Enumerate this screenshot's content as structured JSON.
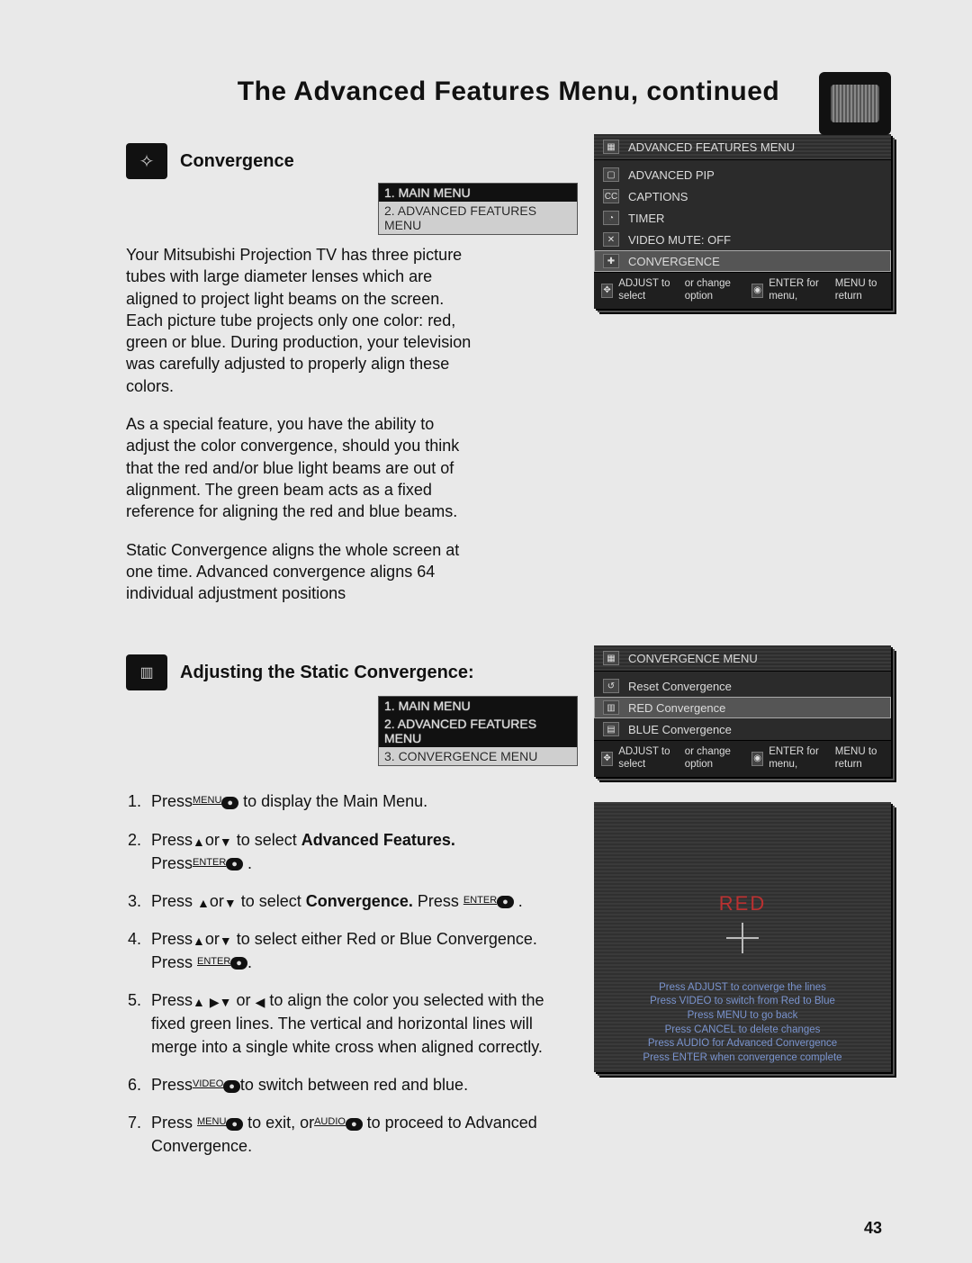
{
  "title": "The Advanced Features Menu, continued",
  "page_number": "43",
  "section1": {
    "heading": "Convergence",
    "crumbs": {
      "line1": "1. MAIN MENU",
      "line2": "2. ADVANCED FEATURES MENU"
    },
    "p1": "Your Mitsubishi Projection TV has three picture tubes with large diameter lenses which are aligned to project light beams on the screen. Each picture tube projects only one color: red, green or blue. During production, your television was carefully adjusted to properly align these colors.",
    "p2": "As a special feature, you have the ability to adjust the color convergence, should you think that the red and/or blue light beams are out of alignment. The green beam acts as a fixed reference for aligning the red and blue beams.",
    "p3": "Static Convergence aligns the whole screen at one time. Advanced convergence aligns 64 individual adjustment positions"
  },
  "tv1": {
    "header": "ADVANCED FEATURES MENU",
    "items": {
      "a": "ADVANCED PIP",
      "b": "CAPTIONS",
      "c": "TIMER",
      "d": "VIDEO MUTE: OFF",
      "e": "CONVERGENCE"
    },
    "foot_l1": "ADJUST  to select",
    "foot_l2": "or change option",
    "foot_r1": "ENTER for menu,",
    "foot_r2": "MENU to return"
  },
  "section2": {
    "heading": "Adjusting the Static Convergence:",
    "crumbs": {
      "line1": "1. MAIN MENU",
      "line2": "2. ADVANCED FEATURES MENU",
      "line3": "3. CONVERGENCE MENU"
    }
  },
  "tv2": {
    "header": "CONVERGENCE MENU",
    "items": {
      "a": "Reset Convergence",
      "b": "RED Convergence",
      "c": "BLUE Convergence"
    },
    "foot_l1": "ADJUST  to select",
    "foot_l2": "or change option",
    "foot_r1": "ENTER for menu,",
    "foot_r2": "MENU to return"
  },
  "redscreen": {
    "title": "RED",
    "l1": "Press ADJUST to converge the lines",
    "l2": "Press VIDEO to switch from Red to Blue",
    "l3": "Press MENU to go back",
    "l4": "Press CANCEL to delete changes",
    "l5": "Press AUDIO for Advanced Convergence",
    "l6": "Press ENTER when convergence complete"
  },
  "steps": {
    "s1a": "Press",
    "s1_btn_sup": "MENU",
    "s1b": " to display the Main Menu.",
    "s2a": "Press",
    "s2_mid": "or",
    "s2b": " to select ",
    "s2_bold": "Advanced Features.",
    "s2c": "Press",
    "s2_sup": "ENTER",
    "s2d": " .",
    "s3a": "Press ",
    "s3_mid": "or",
    "s3b": " to select ",
    "s3_bold": "Convergence.",
    "s3c": " Press ",
    "s3_sup": "ENTER",
    "s3d": " .",
    "s4a": "Press",
    "s4_mid": "or",
    "s4b": " to select either Red or Blue Convergence. Press ",
    "s4_sup": "ENTER",
    "s4c": ".",
    "s5a": "Press",
    "s5_mid": "or",
    "s5b": " to align the color you selected with the fixed green lines. The vertical and horizontal lines will merge into a single white cross when aligned correctly.",
    "s6a": "Press",
    "s6_sup": "VIDEO",
    "s6b": "to switch between red and blue.",
    "s7a": "Press ",
    "s7_sup1": "MENU",
    "s7b": " to exit, or",
    "s7_sup2": "AUDIO",
    "s7c": " to proceed to Advanced Convergence."
  },
  "icons": {
    "adjust": "✥",
    "enter": "◉",
    "menu": "◎",
    "cc": "CC",
    "timer": "◔",
    "pip": "▢",
    "conv": "✚"
  }
}
